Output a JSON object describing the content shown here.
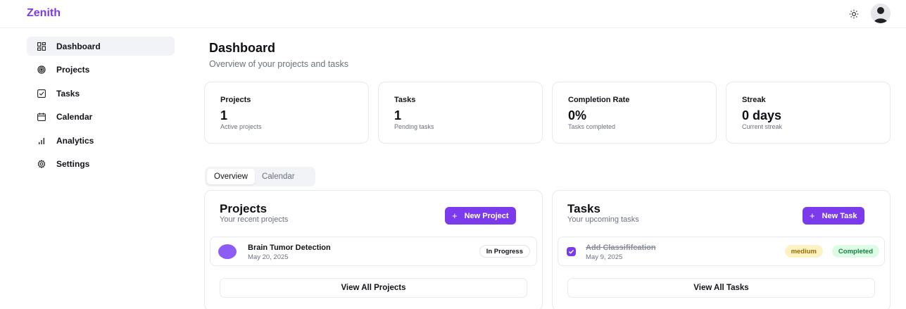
{
  "app": {
    "brand": "Zenith"
  },
  "header": {
    "theme_icon": "sun-icon",
    "avatar_icon": "user-avatar"
  },
  "sidebar": {
    "items": [
      {
        "label": "Dashboard",
        "icon": "dashboard-grid-icon",
        "active": true
      },
      {
        "label": "Projects",
        "icon": "target-icon",
        "active": false
      },
      {
        "label": "Tasks",
        "icon": "checkbox-icon",
        "active": false
      },
      {
        "label": "Calendar",
        "icon": "calendar-icon",
        "active": false
      },
      {
        "label": "Analytics",
        "icon": "bar-chart-icon",
        "active": false
      },
      {
        "label": "Settings",
        "icon": "gear-icon",
        "active": false
      }
    ]
  },
  "page": {
    "title": "Dashboard",
    "subtitle": "Overview of your projects and tasks"
  },
  "stats": [
    {
      "label": "Projects",
      "value": "1",
      "sub": "Active projects"
    },
    {
      "label": "Tasks",
      "value": "1",
      "sub": "Pending tasks"
    },
    {
      "label": "Completion Rate",
      "value": "0%",
      "sub": "Tasks completed"
    },
    {
      "label": "Streak",
      "value": "0 days",
      "sub": "Current streak"
    }
  ],
  "tabs": [
    {
      "label": "Overview",
      "active": true
    },
    {
      "label": "Calendar",
      "active": false
    }
  ],
  "projects_panel": {
    "title": "Projects",
    "subtitle": "Your recent projects",
    "new_button": "New Project",
    "items": [
      {
        "name": "Brain Tumor Detection",
        "date": "May 20, 2025",
        "status": "In Progress",
        "color": "#8b5cf6"
      }
    ],
    "view_all": "View All Projects"
  },
  "tasks_panel": {
    "title": "Tasks",
    "subtitle": "Your upcoming tasks",
    "new_button": "New Task",
    "items": [
      {
        "name": "Add Classififcation",
        "date": "May 9, 2025",
        "priority": "medium",
        "status": "Completed",
        "checked": true
      }
    ],
    "view_all": "View All Tasks"
  },
  "colors": {
    "accent": "#7c3aed",
    "active_bg": "#f1f3f6",
    "completed_bg": "#dcfce7",
    "medium_bg": "#fdf2c4"
  }
}
